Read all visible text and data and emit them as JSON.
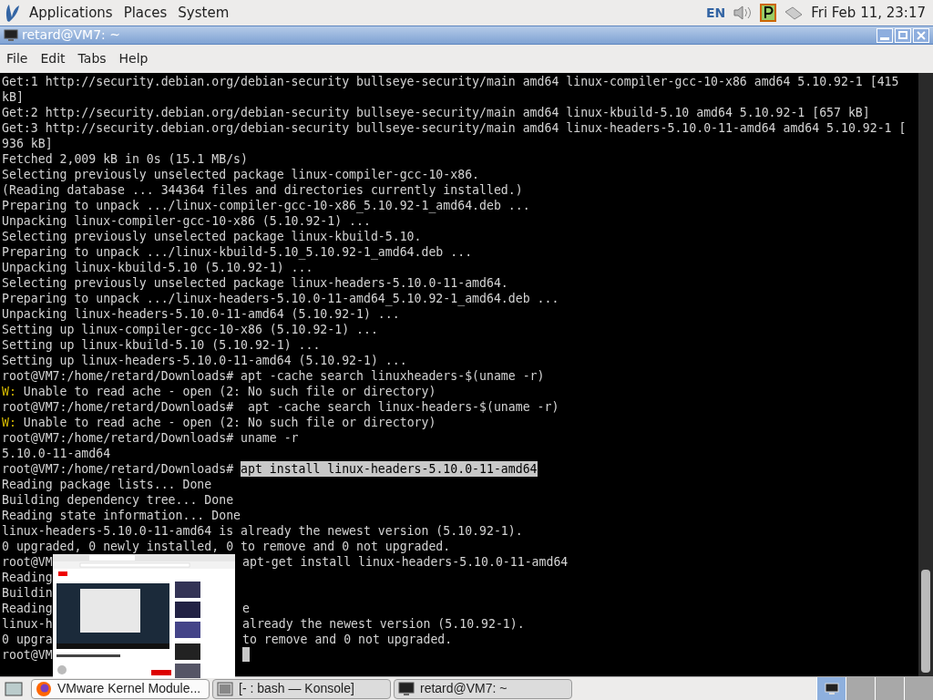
{
  "top_panel": {
    "menus": [
      "Applications",
      "Places",
      "System"
    ],
    "keyboard_layout": "EN",
    "clock": "Fri Feb 11, 23:17"
  },
  "window": {
    "title": "retard@VM7: ~",
    "menu": [
      "File",
      "Edit",
      "Tabs",
      "Help"
    ]
  },
  "terminal": {
    "lines": [
      {
        "spans": [
          {
            "kind": "plain",
            "text": "Get:1 http://security.debian.org/debian-security bullseye-security/main amd64 linux-compiler-gcc-10-x86 amd64 5.10.92-1 [415"
          }
        ]
      },
      {
        "spans": [
          {
            "kind": "plain",
            "text": "kB]"
          }
        ]
      },
      {
        "spans": [
          {
            "kind": "plain",
            "text": "Get:2 http://security.debian.org/debian-security bullseye-security/main amd64 linux-kbuild-5.10 amd64 5.10.92-1 [657 kB]"
          }
        ]
      },
      {
        "spans": [
          {
            "kind": "plain",
            "text": "Get:3 http://security.debian.org/debian-security bullseye-security/main amd64 linux-headers-5.10.0-11-amd64 amd64 5.10.92-1 ["
          }
        ]
      },
      {
        "spans": [
          {
            "kind": "plain",
            "text": "936 kB]"
          }
        ]
      },
      {
        "spans": [
          {
            "kind": "plain",
            "text": "Fetched 2,009 kB in 0s (15.1 MB/s)"
          }
        ]
      },
      {
        "spans": [
          {
            "kind": "plain",
            "text": "Selecting previously unselected package linux-compiler-gcc-10-x86."
          }
        ]
      },
      {
        "spans": [
          {
            "kind": "plain",
            "text": "(Reading database ... 344364 files and directories currently installed.)"
          }
        ]
      },
      {
        "spans": [
          {
            "kind": "plain",
            "text": "Preparing to unpack .../linux-compiler-gcc-10-x86_5.10.92-1_amd64.deb ..."
          }
        ]
      },
      {
        "spans": [
          {
            "kind": "plain",
            "text": "Unpacking linux-compiler-gcc-10-x86 (5.10.92-1) ..."
          }
        ]
      },
      {
        "spans": [
          {
            "kind": "plain",
            "text": "Selecting previously unselected package linux-kbuild-5.10."
          }
        ]
      },
      {
        "spans": [
          {
            "kind": "plain",
            "text": "Preparing to unpack .../linux-kbuild-5.10_5.10.92-1_amd64.deb ..."
          }
        ]
      },
      {
        "spans": [
          {
            "kind": "plain",
            "text": "Unpacking linux-kbuild-5.10 (5.10.92-1) ..."
          }
        ]
      },
      {
        "spans": [
          {
            "kind": "plain",
            "text": "Selecting previously unselected package linux-headers-5.10.0-11-amd64."
          }
        ]
      },
      {
        "spans": [
          {
            "kind": "plain",
            "text": "Preparing to unpack .../linux-headers-5.10.0-11-amd64_5.10.92-1_amd64.deb ..."
          }
        ]
      },
      {
        "spans": [
          {
            "kind": "plain",
            "text": "Unpacking linux-headers-5.10.0-11-amd64 (5.10.92-1) ..."
          }
        ]
      },
      {
        "spans": [
          {
            "kind": "plain",
            "text": "Setting up linux-compiler-gcc-10-x86 (5.10.92-1) ..."
          }
        ]
      },
      {
        "spans": [
          {
            "kind": "plain",
            "text": "Setting up linux-kbuild-5.10 (5.10.92-1) ..."
          }
        ]
      },
      {
        "spans": [
          {
            "kind": "plain",
            "text": "Setting up linux-headers-5.10.0-11-amd64 (5.10.92-1) ..."
          }
        ]
      },
      {
        "spans": [
          {
            "kind": "plain",
            "text": "root@VM7:/home/retard/Downloads# apt -cache search linuxheaders-$(uname -r)"
          }
        ]
      },
      {
        "spans": [
          {
            "kind": "warning",
            "text": "W:"
          },
          {
            "kind": "plain",
            "text": " Unable to read ache - open (2: No such file or directory)"
          }
        ]
      },
      {
        "spans": [
          {
            "kind": "plain",
            "text": "root@VM7:/home/retard/Downloads#  apt -cache search linux-headers-$(uname -r)"
          }
        ]
      },
      {
        "spans": [
          {
            "kind": "warning",
            "text": "W:"
          },
          {
            "kind": "plain",
            "text": " Unable to read ache - open (2: No such file or directory)"
          }
        ]
      },
      {
        "spans": [
          {
            "kind": "plain",
            "text": "root@VM7:/home/retard/Downloads# uname -r"
          }
        ]
      },
      {
        "spans": [
          {
            "kind": "plain",
            "text": "5.10.0-11-amd64"
          }
        ]
      },
      {
        "spans": [
          {
            "kind": "plain",
            "text": "root@VM7:/home/retard/Downloads# "
          },
          {
            "kind": "selected",
            "text": "apt install linux-headers-5.10.0-11-amd64"
          }
        ]
      },
      {
        "spans": [
          {
            "kind": "plain",
            "text": "Reading package lists... Done"
          }
        ]
      },
      {
        "spans": [
          {
            "kind": "plain",
            "text": "Building dependency tree... Done"
          }
        ]
      },
      {
        "spans": [
          {
            "kind": "plain",
            "text": "Reading state information... Done"
          }
        ]
      },
      {
        "spans": [
          {
            "kind": "plain",
            "text": "linux-headers-5.10.0-11-amd64 is already the newest version (5.10.92-1)."
          }
        ]
      },
      {
        "spans": [
          {
            "kind": "plain",
            "text": "0 upgraded, 0 newly installed, 0 to remove and 0 not upgraded."
          }
        ]
      },
      {
        "left": "root@VM",
        "right": "apt-get install linux-headers-5.10.0-11-amd64"
      },
      {
        "left": "Reading"
      },
      {
        "left": "Buildin"
      },
      {
        "left": "Reading",
        "right": "e"
      },
      {
        "left": "linux-h",
        "right": "already the newest version (5.10.92-1)."
      },
      {
        "left": "0 upgra",
        "right": "to remove and 0 not upgraded."
      },
      {
        "left": "root@VM",
        "cursor": true
      }
    ]
  },
  "taskbar": {
    "tasks": [
      {
        "label": "VMware Kernel Module...",
        "hovered": true
      },
      {
        "label": "[- : bash — Konsole]",
        "hovered": false
      },
      {
        "label": "retard@VM7: ~",
        "hovered": false
      }
    ],
    "workspaces": [
      {
        "selected": true
      },
      {
        "selected": false
      },
      {
        "selected": false
      },
      {
        "selected": false
      }
    ]
  }
}
